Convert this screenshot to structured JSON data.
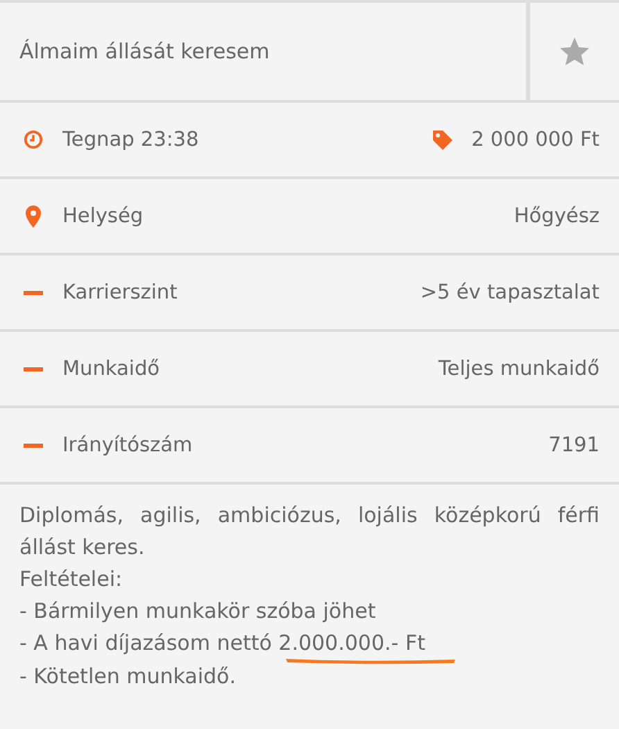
{
  "title": "Álmaim állását keresem",
  "favorite": {
    "selected": false
  },
  "meta": {
    "date": "Tegnap 23:38",
    "price": "2 000 000 Ft"
  },
  "details": [
    {
      "kind": "location",
      "label": "Helység",
      "value": "Hőgyész"
    },
    {
      "kind": "plain",
      "label": "Karrierszint",
      "value": ">5 év tapasztalat"
    },
    {
      "kind": "plain",
      "label": "Munkaidő",
      "value": "Teljes munkaidő"
    },
    {
      "kind": "plain",
      "label": "Irányítószám",
      "value": "7191"
    }
  ],
  "description": [
    {
      "text": "Diplomás, agilis, ambiciózus, lojális középkorú férfi állást keres.",
      "underlined": false
    },
    {
      "text": "Feltételei:",
      "underlined": false
    },
    {
      "text": "- Bármilyen munkakör szóba jöhet",
      "underlined": false
    },
    {
      "text": "- A havi díjazásom nettó 2.000.000.- Ft",
      "underlined": true
    },
    {
      "text": "- Kötetlen munkaidő.",
      "underlined": false
    }
  ]
}
